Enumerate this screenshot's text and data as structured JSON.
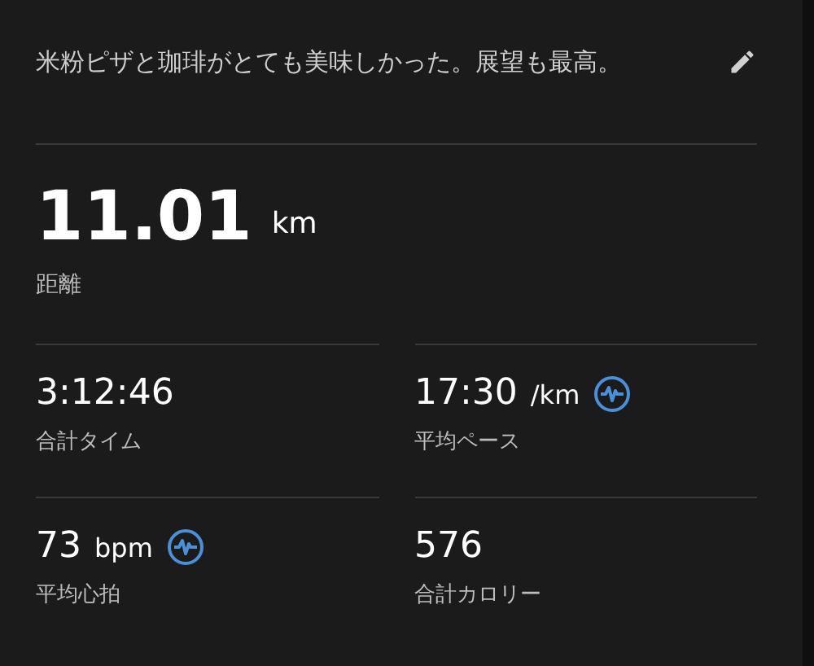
{
  "note": "米粉ピザと珈琲がとても美味しかった。展望も最高。",
  "distance": {
    "value": "11.01",
    "unit": "km",
    "label": "距離"
  },
  "stats": [
    {
      "value": "3:12:46",
      "label": "合計タイム",
      "badge": false
    },
    {
      "value": "17:30",
      "unit": "/km",
      "label": "平均ペース",
      "badge": true
    },
    {
      "value": "73",
      "unit": "bpm",
      "label": "平均心拍",
      "badge": true
    },
    {
      "value": "576",
      "label": "合計カロリー",
      "badge": false
    }
  ]
}
